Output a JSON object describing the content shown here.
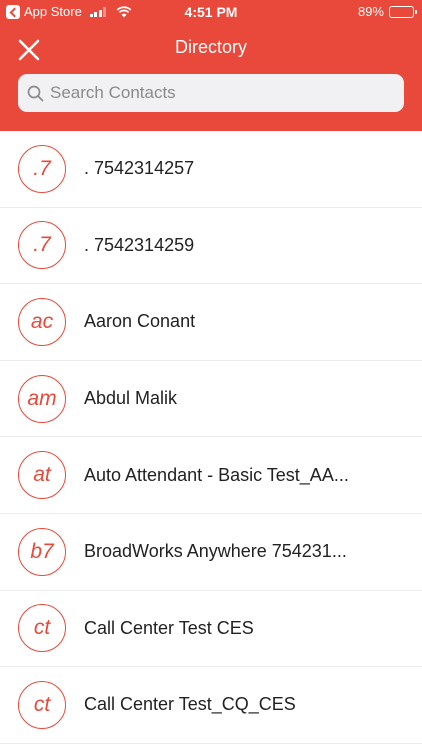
{
  "status_bar": {
    "back_app": "App Store",
    "time": "4:51 PM",
    "battery": "89%",
    "battery_level": 0.89
  },
  "header": {
    "title": "Directory",
    "close_icon": "close-icon"
  },
  "search": {
    "placeholder": "Search Contacts",
    "value": ""
  },
  "colors": {
    "accent": "#e8493a",
    "text": "#222222",
    "divider": "#ececec"
  },
  "contacts": [
    {
      "initials": ".7",
      "name": ". 7542314257"
    },
    {
      "initials": ".7",
      "name": ". 7542314259"
    },
    {
      "initials": "ac",
      "name": "Aaron Conant"
    },
    {
      "initials": "am",
      "name": "Abdul Malik"
    },
    {
      "initials": "at",
      "name": "Auto Attendant - Basic Test_AA..."
    },
    {
      "initials": "b7",
      "name": "BroadWorks Anywhere 754231..."
    },
    {
      "initials": "ct",
      "name": "Call Center Test CES"
    },
    {
      "initials": "ct",
      "name": "Call Center Test_CQ_CES"
    }
  ]
}
